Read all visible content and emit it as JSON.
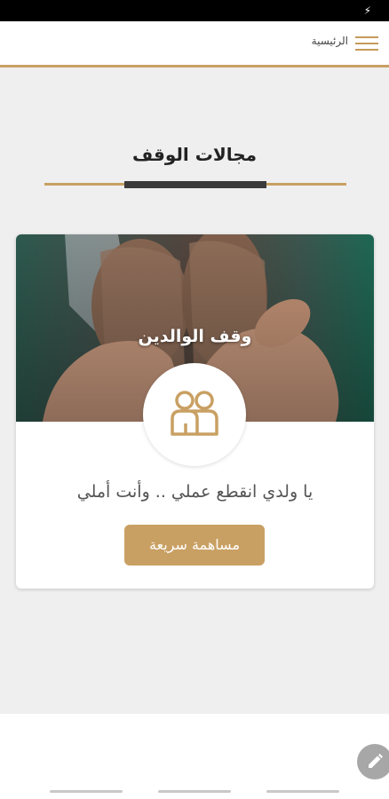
{
  "status_bar": {
    "icon": "charging-bolt-icon"
  },
  "header": {
    "home_label": "الرئيسية",
    "menu_icon": "hamburger-menu-icon",
    "accent_color": "#c9a063"
  },
  "section": {
    "title": "مجالات الوقف"
  },
  "card": {
    "title": "وقف الوالدين",
    "icon": "parents-icon",
    "description": "يا ولدي انقطع عملي .. وأنت أملي",
    "button_label": "مساهمة سريعة"
  },
  "fab": {
    "icon": "pencil-icon"
  },
  "colors": {
    "brand": "#c9a063",
    "background": "#efefef",
    "dark_bar": "#3b3b3b"
  }
}
